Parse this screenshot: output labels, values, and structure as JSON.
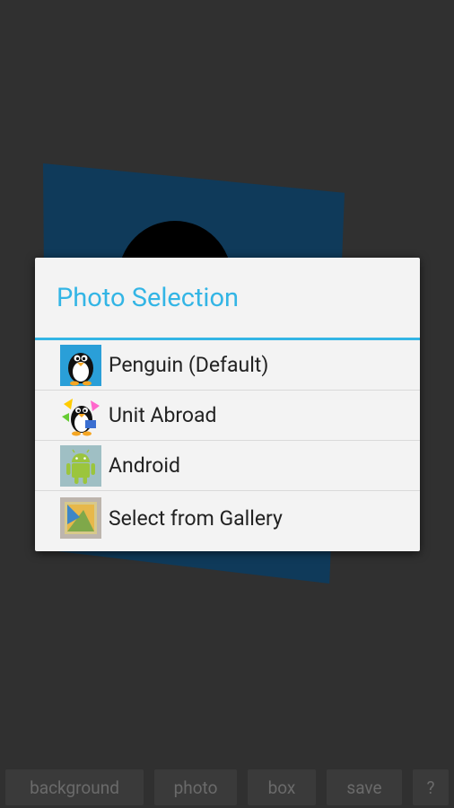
{
  "dialog": {
    "title": "Photo Selection",
    "items": [
      {
        "label": "Penguin (Default)",
        "icon": "penguin-icon"
      },
      {
        "label": "Unit Abroad",
        "icon": "unit-abroad-icon"
      },
      {
        "label": "Android",
        "icon": "android-icon"
      },
      {
        "label": "Select from Gallery",
        "icon": "gallery-icon"
      }
    ]
  },
  "toolbar": {
    "background": "background",
    "photo": "photo",
    "box": "box",
    "save": "save",
    "help": "?"
  },
  "colors": {
    "accent": "#33b5e5",
    "canvas_shape": "#0f3a5a",
    "screen_background": "#303030"
  }
}
